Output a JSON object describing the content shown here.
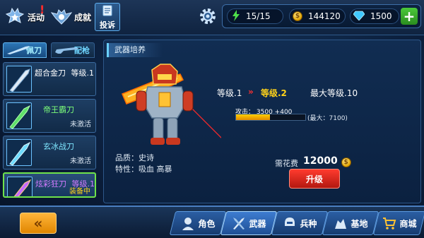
{
  "top_bar": {
    "activity_label": "活动",
    "achievement_label": "成就",
    "complain_label": "投诉",
    "notice_mark": "!",
    "energy": "15/15",
    "gold": "144120",
    "diamond": "1500"
  },
  "tabs": {
    "knife": "佩刀",
    "gun": "配枪"
  },
  "weapon_list": [
    {
      "name": "超合金刀",
      "level": "等级.1",
      "status": ""
    },
    {
      "name": "帝王霸刀",
      "level": "",
      "status": "未激活"
    },
    {
      "name": "玄冰战刀",
      "level": "",
      "status": "未激活"
    },
    {
      "name": "炫彩狂刀",
      "level": "等级.1",
      "status": "装备中"
    }
  ],
  "panel": {
    "title": "武器培养",
    "quality": "品质：史诗",
    "traits": "特性：吸血 高暴",
    "current_level": "等级.1",
    "arrow": "»",
    "next_level": "等级.2",
    "max_level": "最大等级.10",
    "attack_label": "攻击：",
    "attack_value": "3500",
    "attack_bonus": "+400",
    "attack_progress": 0.49,
    "attack_max": "(最大：7100)",
    "cost_label": "需花费",
    "cost_value": "12000",
    "upgrade_label": "升级"
  },
  "bottom_nav": {
    "back": "«",
    "items": [
      {
        "label": "角色",
        "icon": "character-icon"
      },
      {
        "label": "武器",
        "icon": "weapon-icon",
        "active": true
      },
      {
        "label": "兵种",
        "icon": "soldier-icon"
      },
      {
        "label": "基地",
        "icon": "base-icon"
      },
      {
        "label": "商城",
        "icon": "shop-icon"
      }
    ]
  },
  "colors": {
    "accent": "#5fb0f0",
    "upgrade_red": "#e02a1f",
    "level_gold": "#ffd21a",
    "equipped_green": "#6fe34a"
  }
}
